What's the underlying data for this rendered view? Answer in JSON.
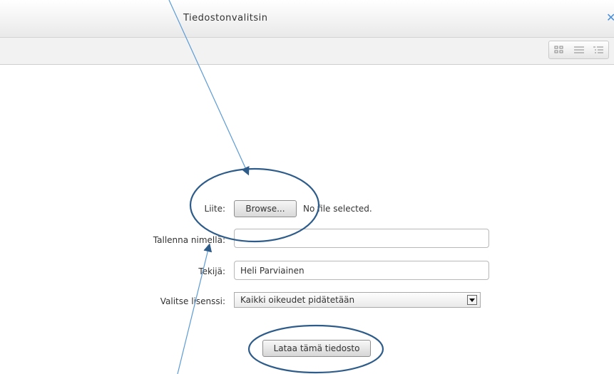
{
  "dialog": {
    "title": "Tiedostonvalitsin",
    "close_icon": "close-icon"
  },
  "toolbar": {
    "view_icons": [
      "grid-view-icon",
      "list-view-icon",
      "tree-view-icon"
    ]
  },
  "form": {
    "attachment_label": "Liite:",
    "browse_label": "Browse...",
    "no_file_text": "No file selected.",
    "save_as_label": "Tallenna nimellä:",
    "save_as_value": "",
    "author_label": "Tekijä:",
    "author_value": "Heli Parviainen",
    "license_label": "Valitse lisenssi:",
    "license_selected": "Kaikki oikeudet pidätetään",
    "upload_button": "Lataa tämä tiedosto"
  },
  "annotation_colors": {
    "stroke": "#2e5c8a",
    "arrow": "#5b9bd5"
  }
}
